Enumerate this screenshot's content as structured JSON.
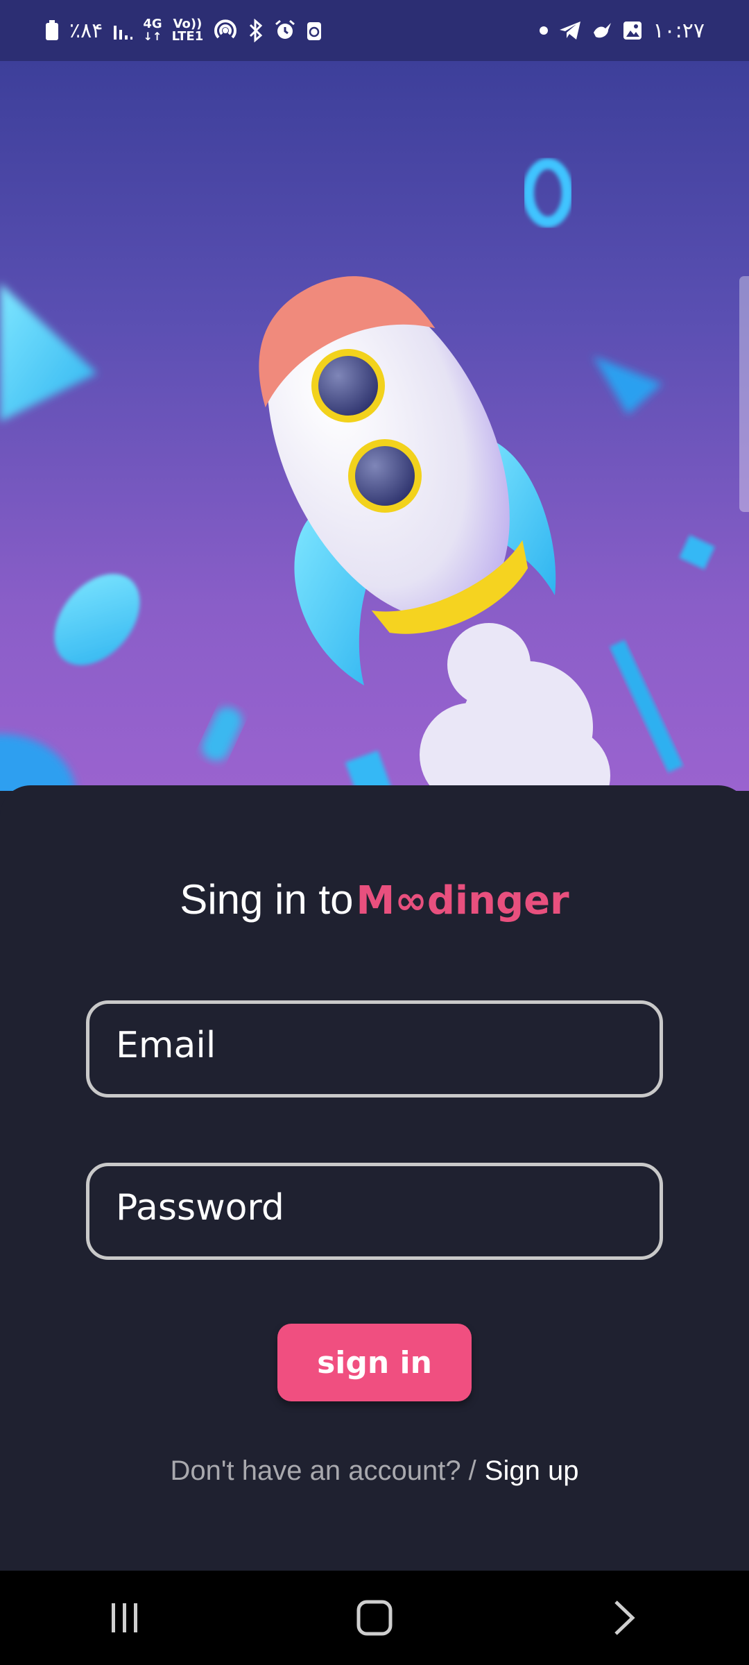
{
  "status_bar": {
    "battery": "٪۸۴",
    "network_4g": "4G",
    "volte_top": "Vo))",
    "volte_bottom": "LTE1",
    "time": "۱۰:۲۷"
  },
  "login": {
    "title_prefix": "Sing in to",
    "brand_name": "M∞dinger",
    "email_placeholder": "Email",
    "password_placeholder": "Password",
    "signin_label": "sign in",
    "no_account_text": "Don't have an account? /",
    "signup_label": "Sign up"
  },
  "colors": {
    "accent": "#f04f80",
    "card_background": "#1f2130",
    "status_bar": "#2c2e73"
  },
  "nav": {
    "recents_icon": "recents-icon",
    "home_icon": "home-icon",
    "back_icon": "back-icon"
  }
}
